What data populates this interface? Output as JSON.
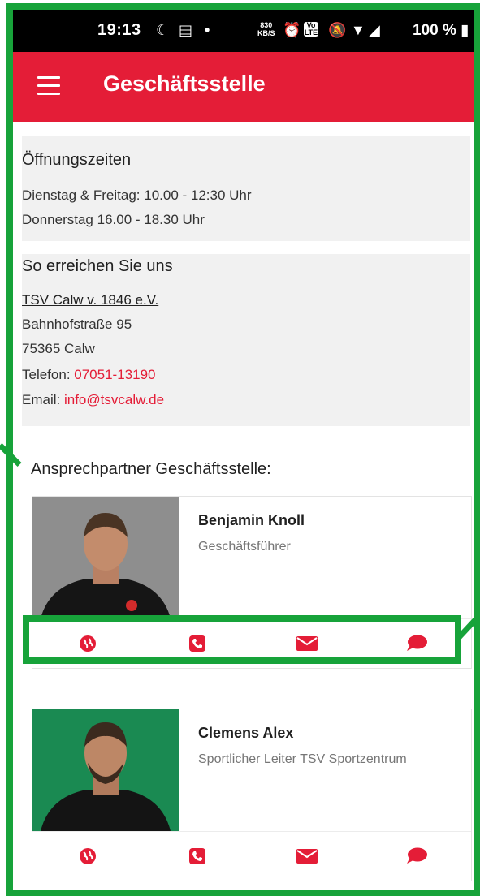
{
  "status_bar": {
    "time": "19:13",
    "data_speed_value": "830",
    "data_speed_unit": "KB/S",
    "volte_label": "Vo LTE",
    "battery": "100 %"
  },
  "app_bar": {
    "title": "Geschäftsstelle"
  },
  "hours": {
    "title": "Öffnungszeiten",
    "lines": [
      "Dienstag & Freitag: 10.00 - 12:30 Uhr",
      "Donnerstag 16.00 - 18.30 Uhr"
    ]
  },
  "contact": {
    "title": "So erreichen Sie uns",
    "org_name": "TSV Calw v. 1846 e.V.",
    "street": "Bahnhofstraße 95",
    "city": "75365 Calw",
    "phone_label": "Telefon: ",
    "phone": "07051-13190",
    "email_label": "Email: ",
    "email": "info@tsvcalw.de"
  },
  "persons_section": {
    "title": "Ansprechpartner Geschäftsstelle:",
    "persons": [
      {
        "name": "Benjamin Knoll",
        "role": "Geschäftsführer",
        "photo_bg": "#8e8e8e"
      },
      {
        "name": "Clemens Alex",
        "role": "Sportlicher Leiter TSV Sportzentrum",
        "photo_bg": "#1a8a52"
      }
    ]
  },
  "actions": {
    "icons": [
      "globe-icon",
      "phone-icon",
      "envelope-icon",
      "chat-bubble-icon"
    ]
  },
  "colors": {
    "accent": "#e41d37",
    "annotation": "#17a33a"
  }
}
